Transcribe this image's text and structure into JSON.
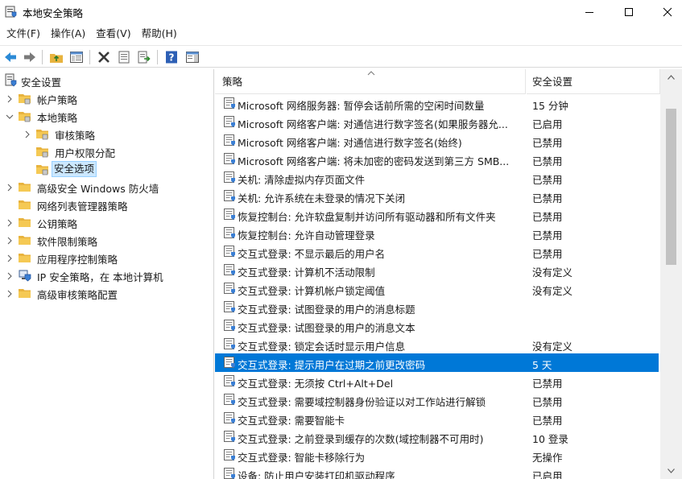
{
  "window": {
    "title": "本地安全策略"
  },
  "menu": [
    "文件(F)",
    "操作(A)",
    "查看(V)",
    "帮助(H)"
  ],
  "toolbar": [
    "back-icon",
    "forward-icon",
    "up-folder-icon",
    "show-hide-tree-icon",
    "delete-icon",
    "properties-icon",
    "export-icon",
    "help-icon",
    "show-pane-icon"
  ],
  "tree": [
    {
      "label": "安全设置",
      "level": 0,
      "icon": "security-settings-icon",
      "expander": "none"
    },
    {
      "label": "帐户策略",
      "level": 1,
      "icon": "folder-icon",
      "expander": "collapsed"
    },
    {
      "label": "本地策略",
      "level": 1,
      "icon": "folder-icon",
      "expander": "expanded"
    },
    {
      "label": "审核策略",
      "level": 2,
      "icon": "folder-icon",
      "expander": "collapsed"
    },
    {
      "label": "用户权限分配",
      "level": 2,
      "icon": "folder-icon",
      "expander": "none"
    },
    {
      "label": "安全选项",
      "level": 2,
      "icon": "folder-icon",
      "expander": "none",
      "selected": true
    },
    {
      "label": "高级安全 Windows 防火墙",
      "level": 1,
      "icon": "folder-icon",
      "expander": "collapsed"
    },
    {
      "label": "网络列表管理器策略",
      "level": 1,
      "icon": "folder-icon",
      "expander": "none"
    },
    {
      "label": "公钥策略",
      "level": 1,
      "icon": "folder-icon",
      "expander": "collapsed"
    },
    {
      "label": "软件限制策略",
      "level": 1,
      "icon": "folder-icon",
      "expander": "collapsed"
    },
    {
      "label": "应用程序控制策略",
      "level": 1,
      "icon": "folder-icon",
      "expander": "collapsed"
    },
    {
      "label": "IP 安全策略，在 本地计算机",
      "level": 1,
      "icon": "ip-security-icon",
      "expander": "collapsed"
    },
    {
      "label": "高级审核策略配置",
      "level": 1,
      "icon": "folder-icon",
      "expander": "collapsed"
    }
  ],
  "list": {
    "columns": [
      "策略",
      "安全设置"
    ],
    "rows": [
      {
        "name": "Microsoft 网络服务器: 暂停会话前所需的空闲时间数量",
        "value": "15 分钟"
      },
      {
        "name": "Microsoft 网络客户端: 对通信进行数字签名(如果服务器允...",
        "value": "已启用"
      },
      {
        "name": "Microsoft 网络客户端: 对通信进行数字签名(始终)",
        "value": "已禁用"
      },
      {
        "name": "Microsoft 网络客户端: 将未加密的密码发送到第三方 SMB...",
        "value": "已禁用"
      },
      {
        "name": "关机: 清除虚拟内存页面文件",
        "value": "已禁用"
      },
      {
        "name": "关机: 允许系统在未登录的情况下关闭",
        "value": "已禁用"
      },
      {
        "name": "恢复控制台: 允许软盘复制并访问所有驱动器和所有文件夹",
        "value": "已禁用"
      },
      {
        "name": "恢复控制台: 允许自动管理登录",
        "value": "已禁用"
      },
      {
        "name": "交互式登录: 不显示最后的用户名",
        "value": "已禁用"
      },
      {
        "name": "交互式登录: 计算机不活动限制",
        "value": "没有定义"
      },
      {
        "name": "交互式登录: 计算机帐户锁定阈值",
        "value": "没有定义"
      },
      {
        "name": "交互式登录: 试图登录的用户的消息标题",
        "value": ""
      },
      {
        "name": "交互式登录: 试图登录的用户的消息文本",
        "value": ""
      },
      {
        "name": "交互式登录: 锁定会话时显示用户信息",
        "value": "没有定义"
      },
      {
        "name": "交互式登录: 提示用户在过期之前更改密码",
        "value": "5 天",
        "selected": true
      },
      {
        "name": "交互式登录: 无须按 Ctrl+Alt+Del",
        "value": "已禁用"
      },
      {
        "name": "交互式登录: 需要域控制器身份验证以对工作站进行解锁",
        "value": "已禁用"
      },
      {
        "name": "交互式登录: 需要智能卡",
        "value": "已禁用"
      },
      {
        "name": "交互式登录: 之前登录到缓存的次数(域控制器不可用时)",
        "value": "10 登录"
      },
      {
        "name": "交互式登录: 智能卡移除行为",
        "value": "无操作"
      },
      {
        "name": "设备: 防止用户安装打印机驱动程序",
        "value": "已启用"
      }
    ]
  },
  "colors": {
    "selection": "#0078d7",
    "tree_selection": "#cce8ff",
    "folder": "#e8b33e"
  }
}
